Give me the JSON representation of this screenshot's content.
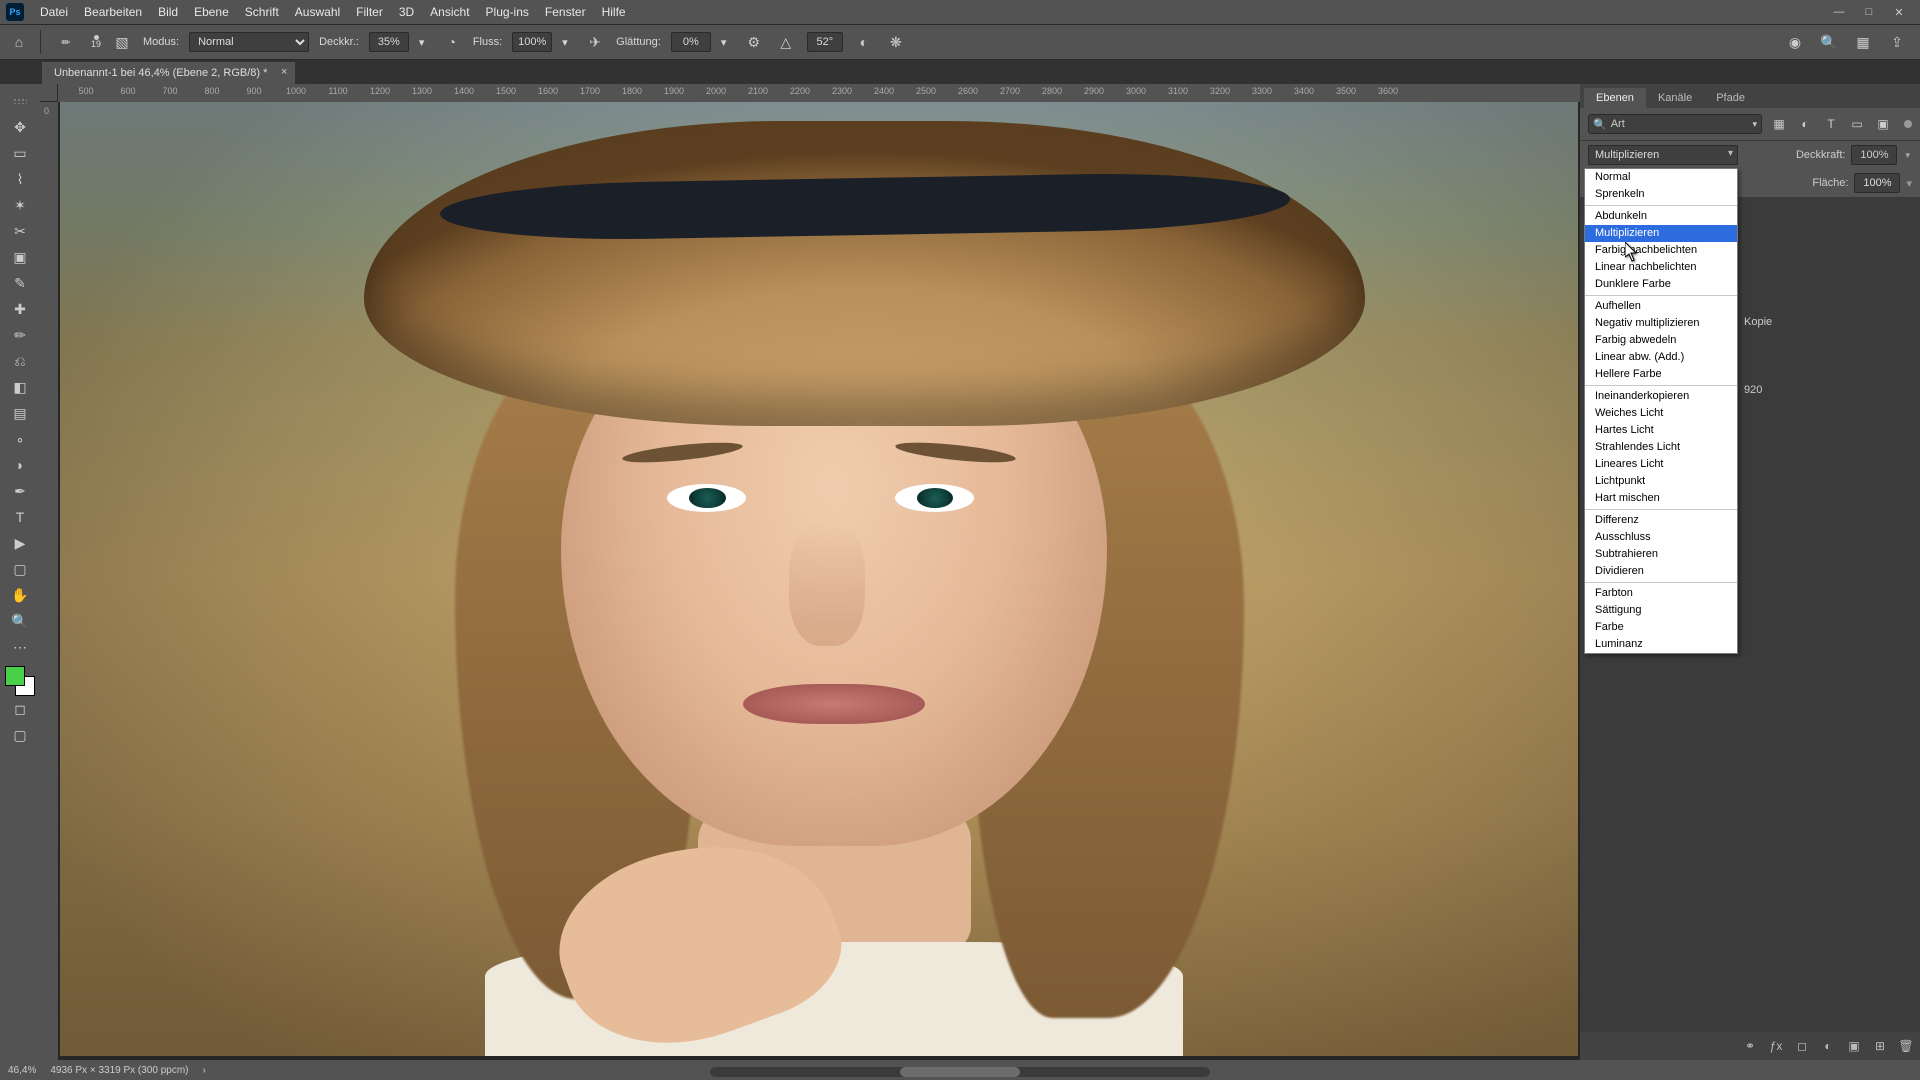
{
  "menu": {
    "items": [
      "Datei",
      "Bearbeiten",
      "Bild",
      "Ebene",
      "Schrift",
      "Auswahl",
      "Filter",
      "3D",
      "Ansicht",
      "Plug-ins",
      "Fenster",
      "Hilfe"
    ],
    "logo": "Ps"
  },
  "window_controls": {
    "min": "—",
    "max": "□",
    "close": "✕"
  },
  "options": {
    "brush_size_label": "19",
    "mode_label": "Modus:",
    "mode_value": "Normal",
    "opacity_label": "Deckkr.:",
    "opacity_value": "35%",
    "flow_label": "Fluss:",
    "flow_value": "100%",
    "smooth_label": "Glättung:",
    "smooth_value": "0%",
    "angle_value": "52°"
  },
  "doc": {
    "title": "Unbenannt-1 bei 46,4% (Ebene 2, RGB/8) *"
  },
  "ruler_ticks": [
    "500",
    "600",
    "700",
    "800",
    "900",
    "1000",
    "1100",
    "1200",
    "1300",
    "1400",
    "1500",
    "1600",
    "1700",
    "1800",
    "1900",
    "2000",
    "2100",
    "2200",
    "2300",
    "2400",
    "2500",
    "2600",
    "2700",
    "2800",
    "2900",
    "3000",
    "3100",
    "3200",
    "3300",
    "3400",
    "3500",
    "3600"
  ],
  "ruler_v_tick": "0",
  "tools": [
    {
      "name": "move-tool",
      "glyph": "✥"
    },
    {
      "name": "marquee-tool",
      "glyph": "▭"
    },
    {
      "name": "lasso-tool",
      "glyph": "⌇"
    },
    {
      "name": "quick-select-tool",
      "glyph": "✶"
    },
    {
      "name": "crop-tool",
      "glyph": "✂"
    },
    {
      "name": "frame-tool",
      "glyph": "▣"
    },
    {
      "name": "eyedropper-tool",
      "glyph": "✎"
    },
    {
      "name": "healing-brush-tool",
      "glyph": "✚"
    },
    {
      "name": "brush-tool",
      "glyph": "✏"
    },
    {
      "name": "clone-stamp-tool",
      "glyph": "⎌"
    },
    {
      "name": "eraser-tool",
      "glyph": "◧"
    },
    {
      "name": "gradient-tool",
      "glyph": "▤"
    },
    {
      "name": "blur-tool",
      "glyph": "∘"
    },
    {
      "name": "dodge-tool",
      "glyph": "◗"
    },
    {
      "name": "pen-tool",
      "glyph": "✒"
    },
    {
      "name": "type-tool",
      "glyph": "T"
    },
    {
      "name": "path-select-tool",
      "glyph": "▶"
    },
    {
      "name": "shape-tool",
      "glyph": "▢"
    },
    {
      "name": "hand-tool",
      "glyph": "✋"
    },
    {
      "name": "zoom-tool",
      "glyph": "🔍"
    },
    {
      "name": "more-tools",
      "glyph": "⋯"
    }
  ],
  "panels": {
    "tabs": [
      "Ebenen",
      "Kanäle",
      "Pfade"
    ],
    "active_tab": 0,
    "search_placeholder": "Art",
    "blend_mode_current": "Multiplizieren",
    "opacity_label": "Deckkraft:",
    "opacity_value": "100%",
    "fill_label": "Fläche:",
    "fill_value": "100%",
    "lock_label": "",
    "layer_peek_copy": "Kopie",
    "layer_peek_dim": "920"
  },
  "blend_modes": [
    {
      "group": [
        "Normal",
        "Sprenkeln"
      ]
    },
    {
      "group": [
        "Abdunkeln",
        "Multiplizieren",
        "Farbig nachbelichten",
        "Linear nachbelichten",
        "Dunklere Farbe"
      ]
    },
    {
      "group": [
        "Aufhellen",
        "Negativ multiplizieren",
        "Farbig abwedeln",
        "Linear abw. (Add.)",
        "Hellere Farbe"
      ]
    },
    {
      "group": [
        "Ineinanderkopieren",
        "Weiches Licht",
        "Hartes Licht",
        "Strahlendes Licht",
        "Lineares Licht",
        "Lichtpunkt",
        "Hart mischen"
      ]
    },
    {
      "group": [
        "Differenz",
        "Ausschluss",
        "Subtrahieren",
        "Dividieren"
      ]
    },
    {
      "group": [
        "Farbton",
        "Sättigung",
        "Farbe",
        "Luminanz"
      ]
    }
  ],
  "blend_selected": "Multiplizieren",
  "status": {
    "zoom": "46,4%",
    "dims": "4936 Px × 3319 Px (300 ppcm)"
  }
}
